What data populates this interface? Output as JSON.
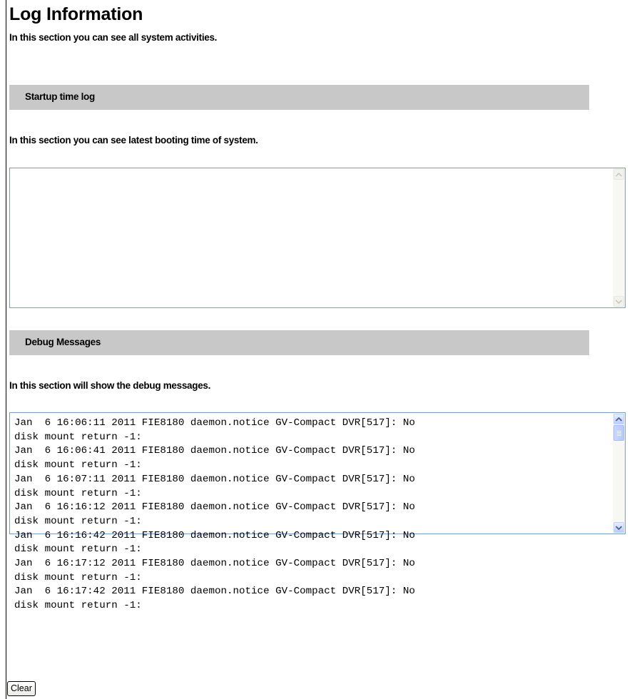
{
  "page": {
    "title": "Log Information",
    "intro": "In this section you can see all system activities."
  },
  "startup_section": {
    "header": "Startup time log",
    "description": "In this section you can see latest booting time of system.",
    "log_text": ""
  },
  "debug_section": {
    "header": "Debug Messages",
    "description": "In this section will show the debug messages.",
    "log_lines": [
      "Jan  6 16:06:11 2011 FIE8180 daemon.notice GV-Compact DVR[517]: No",
      "disk mount return -1:",
      "Jan  6 16:06:41 2011 FIE8180 daemon.notice GV-Compact DVR[517]: No",
      "disk mount return -1:",
      "Jan  6 16:07:11 2011 FIE8180 daemon.notice GV-Compact DVR[517]: No",
      "disk mount return -1:",
      "Jan  6 16:16:12 2011 FIE8180 daemon.notice GV-Compact DVR[517]: No",
      "disk mount return -1:",
      "Jan  6 16:16:42 2011 FIE8180 daemon.notice GV-Compact DVR[517]: No",
      "disk mount return -1:",
      "Jan  6 16:17:12 2011 FIE8180 daemon.notice GV-Compact DVR[517]: No",
      "disk mount return -1:",
      "Jan  6 16:17:42 2011 FIE8180 daemon.notice GV-Compact DVR[517]: No",
      "disk mount return -1:"
    ],
    "scroll_position": 0
  },
  "actions": {
    "clear_label": "Clear"
  },
  "colors": {
    "section_bar": "#c8c8c8",
    "textbox_border": "#7f9db9",
    "scrollbar_button": "#c1d3fb"
  },
  "icons": {
    "scroll_up": "scroll-up-arrow-icon",
    "scroll_down": "scroll-down-arrow-icon"
  }
}
